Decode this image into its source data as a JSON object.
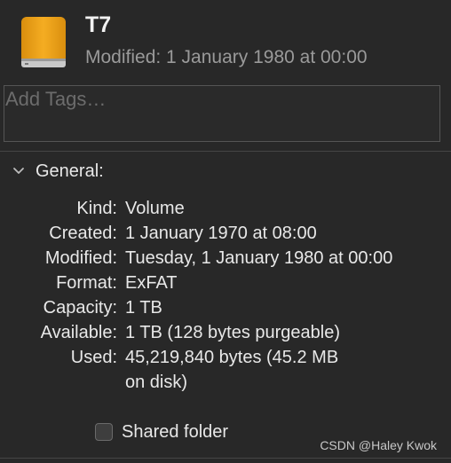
{
  "header": {
    "icon": "external-drive-icon",
    "title": "T7",
    "subtitle": "Modified: 1 January 1980 at 00:00"
  },
  "tags": {
    "placeholder": "Add Tags…"
  },
  "general": {
    "title": "General:",
    "expanded": true,
    "rows": [
      {
        "label": "Kind:",
        "value": "Volume"
      },
      {
        "label": "Created:",
        "value": "1 January 1970 at 08:00"
      },
      {
        "label": "Modified:",
        "value": "Tuesday, 1 January 1980 at 00:00"
      },
      {
        "label": "Format:",
        "value": "ExFAT"
      },
      {
        "label": "Capacity:",
        "value": "1 TB"
      },
      {
        "label": "Available:",
        "value": "1 TB (128 bytes purgeable)"
      },
      {
        "label": "Used:",
        "value": "45,219,840 bytes (45.2 MB",
        "value2": "on disk)"
      }
    ]
  },
  "shared_folder": {
    "label": "Shared folder",
    "checked": false
  },
  "watermark": "CSDN @Haley Kwok",
  "colors": {
    "background": "#282828",
    "drive_orange": "#f0a419",
    "text_primary": "#e8e8e8",
    "text_secondary": "#9a9a9a"
  }
}
